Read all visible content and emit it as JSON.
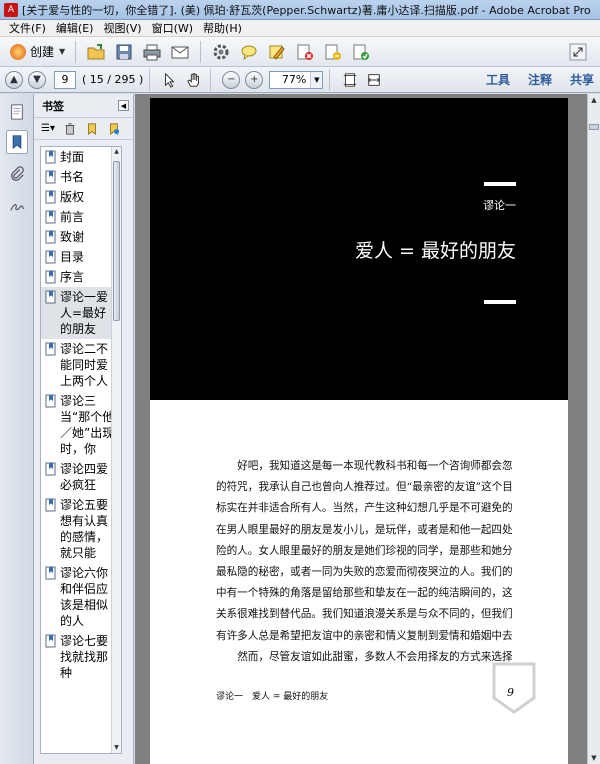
{
  "window": {
    "title": "[关于爱与性的一切，你全错了]. (美) 佩珀·舒瓦茨(Pepper.Schwartz)著.庸小达译.扫描版.pdf - Adobe Acrobat Pro"
  },
  "menu": [
    "文件(F)",
    "编辑(E)",
    "视图(V)",
    "窗口(W)",
    "帮助(H)"
  ],
  "toolbar": {
    "create_label": "创建",
    "icons": [
      "open-folder-icon",
      "save-icon",
      "print-icon",
      "email-icon",
      "settings-icon",
      "comment-icon",
      "highlight-icon",
      "reject-icon",
      "sign-icon",
      "export-icon"
    ]
  },
  "nav": {
    "page_value": "9",
    "page_count": "( 15 / 295 )",
    "zoom": "77%",
    "links": [
      "工具",
      "注释",
      "共享"
    ]
  },
  "bookmarks": {
    "title": "书签",
    "items": [
      {
        "label": "封面"
      },
      {
        "label": "书名"
      },
      {
        "label": "版权"
      },
      {
        "label": "前言"
      },
      {
        "label": "致谢"
      },
      {
        "label": "目录"
      },
      {
        "label": "序言"
      },
      {
        "label": "谬论一爱人=最好的朋友",
        "selected": true
      },
      {
        "label": "谬论二不能同时爱上两个人"
      },
      {
        "label": "谬论三当“那个他／她”出现时，你"
      },
      {
        "label": "谬论四爱必疯狂"
      },
      {
        "label": "谬论五要想有认真的感情，就只能"
      },
      {
        "label": "谬论六你和伴侣应该是相似的人"
      },
      {
        "label": "谬论七要找就找那种"
      }
    ]
  },
  "document": {
    "chapter_label": "谬论一",
    "chapter_title": "爱人 = 最好的朋友",
    "paragraphs": [
      "好吧，我知道这是每一本现代教科书和每一个咨询师都会忽叨",
      "的符咒，我承认自己也曾向人推荐过。但“最亲密的友谊”这个目",
      "标实在并非适合所有人。当然，产生这种幻想几乎是不可避免的。",
      "在男人眼里最好的朋友是发小儿，是玩伴，或者是和他一起四处探",
      "险的人。女人眼里最好的朋友是她们珍视的同学，是那些和她分享",
      "最私隐的秘密，或者一同为失败的恋爱而彻夜哭泣的人。我们的心",
      "中有一个特殊的角落是留给那些和挚友在一起的纯洁瞬间的，这种",
      "关系很难找到替代品。我们知道浪漫关系是与众不同的，但我们中",
      "有许多人总是希望把友谊中的亲密和情义复制到爱情和婚姻中去。",
      "然而，尽管友谊如此甜蜜，多数人不会用择友的方式来选择伴"
    ],
    "footer_left": "谬论一　爱人 = 最好的朋友",
    "page_number": "9"
  }
}
